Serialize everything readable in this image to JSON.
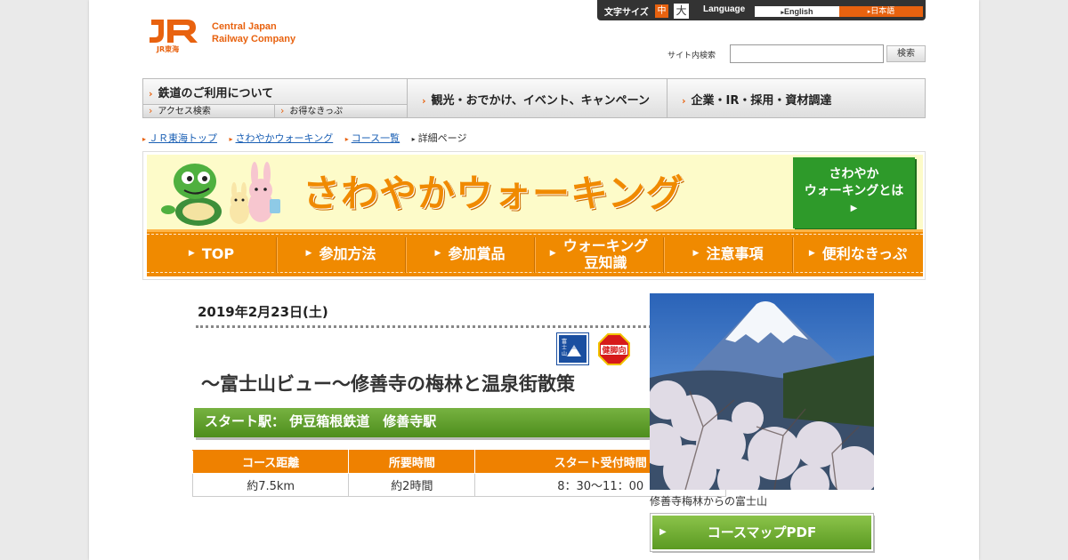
{
  "logo": {
    "mark": "JR",
    "sub": "JR東海",
    "company_line1": "Central Japan",
    "company_line2": "Railway Company"
  },
  "util": {
    "font_size_label": "文字サイズ",
    "font_mid": "中",
    "font_big": "大",
    "language_label": "Language",
    "lang_en": "English",
    "lang_ja": "日本語"
  },
  "search": {
    "label": "サイト内検索",
    "value": "",
    "button": "検索"
  },
  "gnav": {
    "item1": "鉄道のご利用について",
    "item1_sub1": "アクセス検索",
    "item1_sub2": "お得なきっぷ",
    "item2": "観光・おでかけ、イベント、キャンペーン",
    "item3": "企業・IR・採用・資材調達"
  },
  "breadcrumb": {
    "b1": "ＪＲ東海トップ",
    "b2": "さわやかウォーキング",
    "b3": "コース一覧",
    "b4": "詳細ページ"
  },
  "hero": {
    "title": "さわやかウォーキング",
    "about_line1": "さわやか",
    "about_line2": "ウォーキングとは",
    "tabs": {
      "t1": "TOP",
      "t2": "参加方法",
      "t3": "参加賞品",
      "t4_line1": "ウォーキング",
      "t4_line2": "豆知識",
      "t5": "注意事項",
      "t6": "便利なきっぷ"
    }
  },
  "event": {
    "date": "2019年2月23日(土)",
    "badge_fuji": "富士山ビュー",
    "badge_ken": "健脚向",
    "title": "～富士山ビュー～修善寺の梅林と温泉街散策",
    "start_station": "スタート駅： 伊豆箱根鉄道　修善寺駅",
    "table": {
      "headers": [
        "コース距離",
        "所要時間",
        "スタート受付時間"
      ],
      "values": [
        "約7.5km",
        "約2時間",
        "8：30～11：00"
      ]
    },
    "photo_caption": "修善寺梅林からの富士山",
    "pdf_button": "コースマップPDF"
  },
  "colors": {
    "accent": "#e8620f",
    "tab_orange": "#f08a00",
    "green": "#4d8d1c",
    "link": "#1a5fb4"
  }
}
